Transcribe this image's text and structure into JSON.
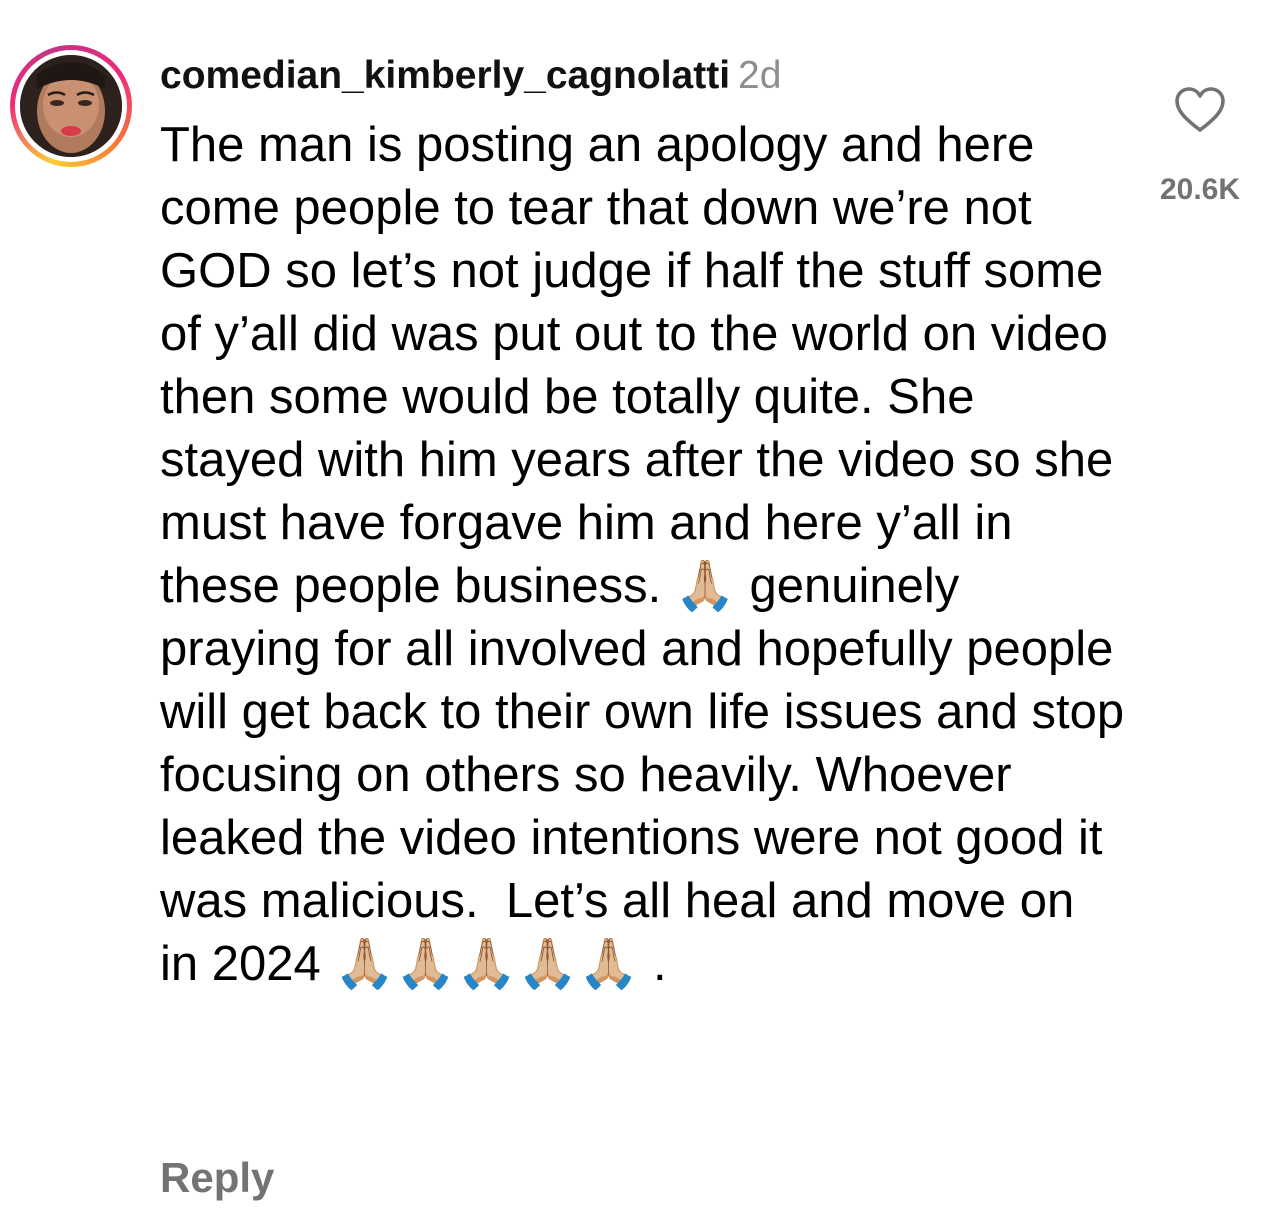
{
  "comment": {
    "username": "comedian_kimberly_cagnolatti",
    "time": "2d",
    "text": "The man is posting an apology and here come people to tear that down we’re not GOD so let’s not judge if half the stuff some of y’all did was put out to the world on video then some would be totally quite. She stayed with him years after the video so she must have forgave him and here y’all in these people business. 🙏🏼 genuinely praying for all involved and hopefully people will get back to their own life issues and stop focusing on others so heavily. Whoever leaked the video intentions were not good it was malicious.  Let’s all heal and move on  in 2024 🙏🏼🙏🏼🙏🏼🙏🏼🙏🏼 .",
    "like_count": "20.6K",
    "reply_label": "Reply",
    "like_icon": "heart-outline-icon"
  },
  "colors": {
    "text": "#000000",
    "secondary": "#8e8e8e",
    "reply": "#737373",
    "ring_start": "#f9ce34",
    "ring_end": "#ee2a7b"
  }
}
